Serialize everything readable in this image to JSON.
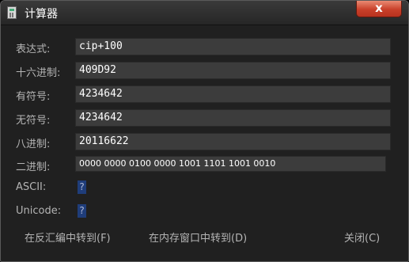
{
  "window": {
    "title": "计算器",
    "close_label": "x"
  },
  "fields": {
    "expression": {
      "label": "表达式:",
      "value": "cip+100"
    },
    "hex": {
      "label": "十六进制:",
      "value": "409D92"
    },
    "signed": {
      "label": "有符号:",
      "value": "4234642"
    },
    "unsigned": {
      "label": "无符号:",
      "value": "4234642"
    },
    "octal": {
      "label": "八进制:",
      "value": "20116622"
    },
    "binary": {
      "label": "二进制:",
      "value": "0000 0000 0100 0000 1001 1101 1001 0010"
    },
    "ascii": {
      "label": "ASCII:",
      "value": "?"
    },
    "unicode": {
      "label": "Unicode:",
      "value": "?"
    }
  },
  "actions": {
    "goto_disasm": "在反汇编中转到(F)",
    "goto_memory": "在内存窗口中转到(D)",
    "close": "关闭(C)"
  },
  "colors": {
    "background": "#202020",
    "field_bg": "#3c3c3c",
    "close_button": "#c9402a",
    "char_highlight": "#1f3d7a"
  }
}
